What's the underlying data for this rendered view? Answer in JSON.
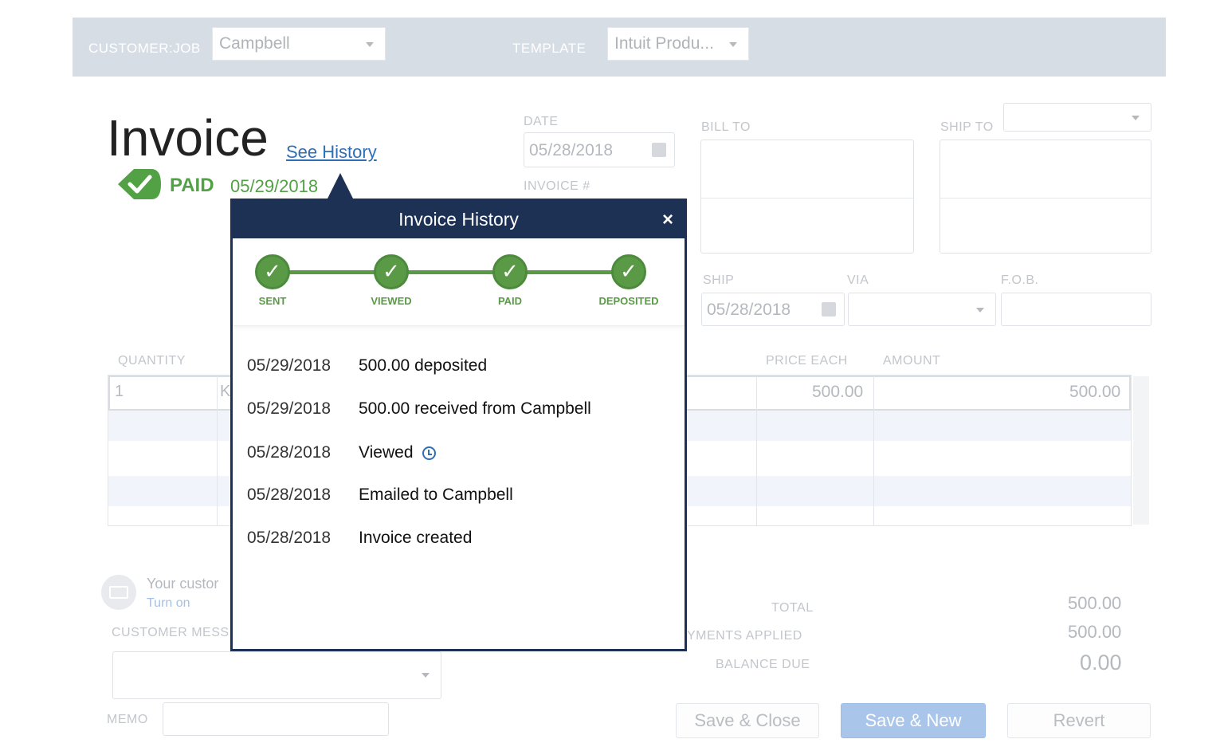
{
  "toolbar": {
    "customer_job_label": "CUSTOMER:JOB",
    "customer_job_value": "Campbell",
    "template_label": "TEMPLATE",
    "template_value": "Intuit Produ..."
  },
  "invoice": {
    "title": "Invoice",
    "see_history": "See History",
    "status": "PAID",
    "status_date": "05/29/2018",
    "date_label": "DATE",
    "date_value": "05/28/2018",
    "invoice_no_label": "INVOICE #",
    "bill_to_label": "BILL TO",
    "ship_to_label": "SHIP TO",
    "ship_label": "SHIP",
    "ship_value": "05/28/2018",
    "via_label": "VIA",
    "fob_label": "F.O.B.",
    "columns": {
      "quantity": "QUANTITY",
      "price_each": "PRICE EACH",
      "amount": "AMOUNT"
    },
    "line": {
      "quantity": "1",
      "item_fragment": "K",
      "price_each": "500.00",
      "amount": "500.00"
    },
    "payment_note": "Your custor",
    "turn_on": "Turn on",
    "customer_message_label": "CUSTOMER MESS",
    "memo_label": "MEMO",
    "totals": {
      "total_label": "TOTAL",
      "total_value": "500.00",
      "payments_label": "YMENTS APPLIED",
      "payments_value": "500.00",
      "balance_label": "BALANCE DUE",
      "balance_value": "0.00"
    }
  },
  "buttons": {
    "save_close": "Save & Close",
    "save_new": "Save & New",
    "revert": "Revert"
  },
  "history_popup": {
    "title": "Invoice History",
    "close": "×",
    "steps": [
      "SENT",
      "VIEWED",
      "PAID",
      "DEPOSITED"
    ],
    "check": "✓",
    "entries": [
      {
        "date": "05/29/2018",
        "text": "500.00 deposited"
      },
      {
        "date": "05/29/2018",
        "text": "500.00 received from Campbell"
      },
      {
        "date": "05/28/2018",
        "text": "Viewed"
      },
      {
        "date": "05/28/2018",
        "text": "Emailed to Campbell"
      },
      {
        "date": "05/28/2018",
        "text": "Invoice created"
      }
    ]
  },
  "colors": {
    "accent_navy": "#1c3153",
    "paid_green": "#53a145",
    "link_blue": "#2e6fb5",
    "toolbar_bg": "#d7dde5",
    "primary_button": "#a9c6ea"
  }
}
